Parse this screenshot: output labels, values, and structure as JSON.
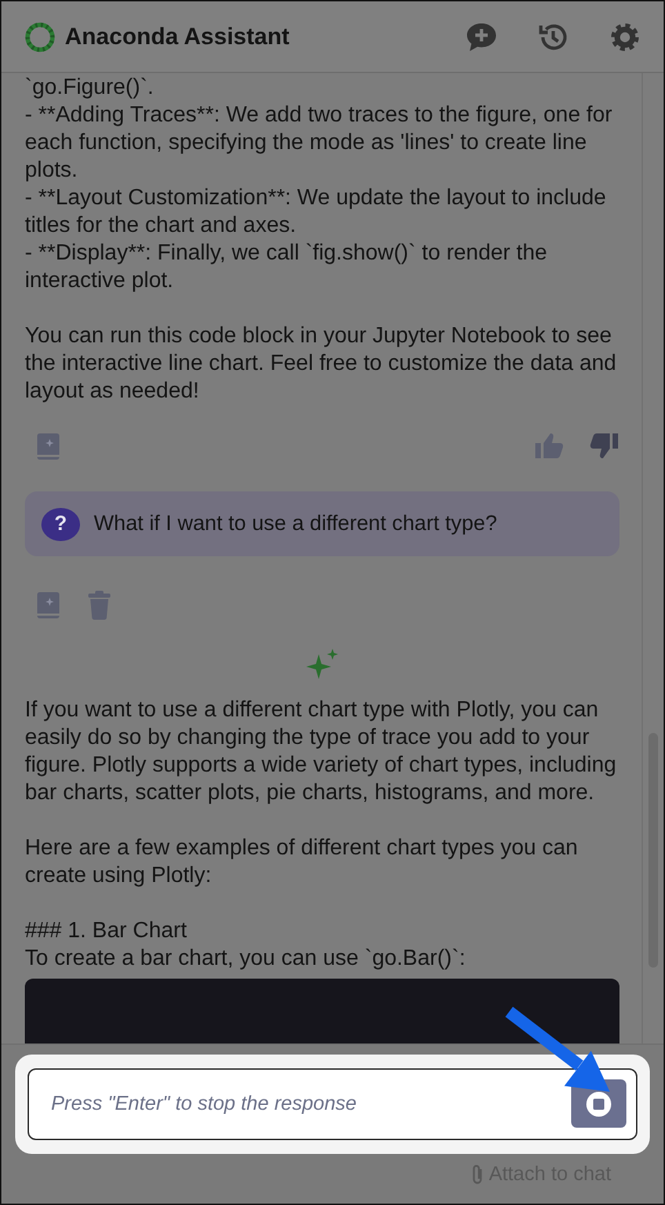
{
  "header": {
    "title": "Anaconda Assistant"
  },
  "conversation": [
    {
      "kind": "text",
      "text": "`go.Figure()`.\n- **Adding Traces**: We add two traces to the figure, one for each function, specifying the mode as 'lines' to create line plots.\n- **Layout Customization**: We update the layout to include titles for the chart and axes.\n- **Display**: Finally, we call `fig.show()` to render the interactive plot.\n\nYou can run this code block in your Jupyter Notebook to see the interactive line chart. Feel free to customize the data and layout as needed!"
    },
    {
      "kind": "feedback"
    },
    {
      "kind": "question",
      "badge": "?",
      "text": "What if I want to use a different chart type?"
    },
    {
      "kind": "question_actions"
    },
    {
      "kind": "responding"
    },
    {
      "kind": "text",
      "text": "If you want to use a different chart type with Plotly, you can easily do so by changing the type of trace you add to your figure. Plotly supports a wide variety of chart types, including bar charts, scatter plots, pie charts, histograms, and more.\n\nHere are a few examples of different chart types you can create using Plotly:\n\n### 1. Bar Chart\nTo create a bar chart, you can use `go.Bar()`:"
    },
    {
      "kind": "code"
    }
  ],
  "composer": {
    "placeholder": "Press \"Enter\" to stop the response",
    "attach_label": "Attach to chat"
  }
}
